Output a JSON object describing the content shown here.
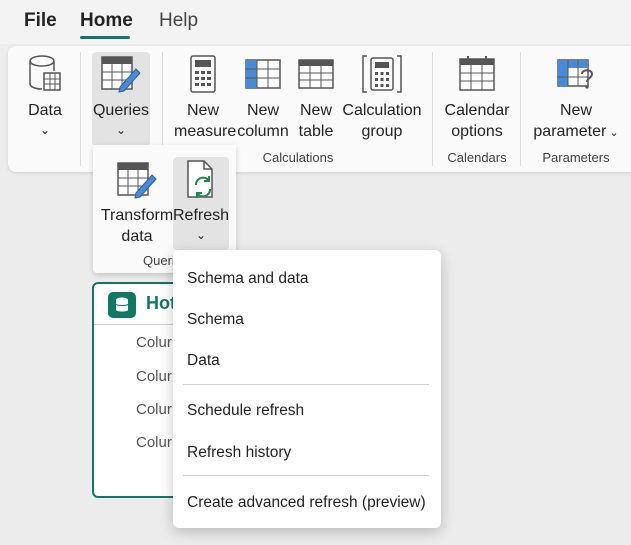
{
  "tabs": {
    "file": "File",
    "home": "Home",
    "help": "Help"
  },
  "ribbon": {
    "data_btn": "Data",
    "queries_btn": "Queries",
    "new_measure": [
      "New",
      "measure"
    ],
    "new_column": [
      "New",
      "column"
    ],
    "new_table": [
      "New",
      "table"
    ],
    "calc_group": [
      "Calculation",
      "group"
    ],
    "calendar_options": [
      "Calendar",
      "options"
    ],
    "new_parameter": [
      "New",
      "parameter"
    ],
    "groups": {
      "calculations": "Calculations",
      "calendars": "Calendars",
      "parameters": "Parameters"
    },
    "accent": "#117865"
  },
  "queries_panel": {
    "transform": [
      "Transform",
      "data"
    ],
    "refresh": "Refresh",
    "group_label": "Queri"
  },
  "table_card": {
    "title": "Hot",
    "columns": [
      "Colur",
      "Colur",
      "Colur",
      "Colur"
    ]
  },
  "refresh_menu": {
    "items": [
      "Schema and data",
      "Schema",
      "Data",
      "Schedule refresh",
      "Refresh history",
      "Create advanced refresh (preview)"
    ]
  }
}
